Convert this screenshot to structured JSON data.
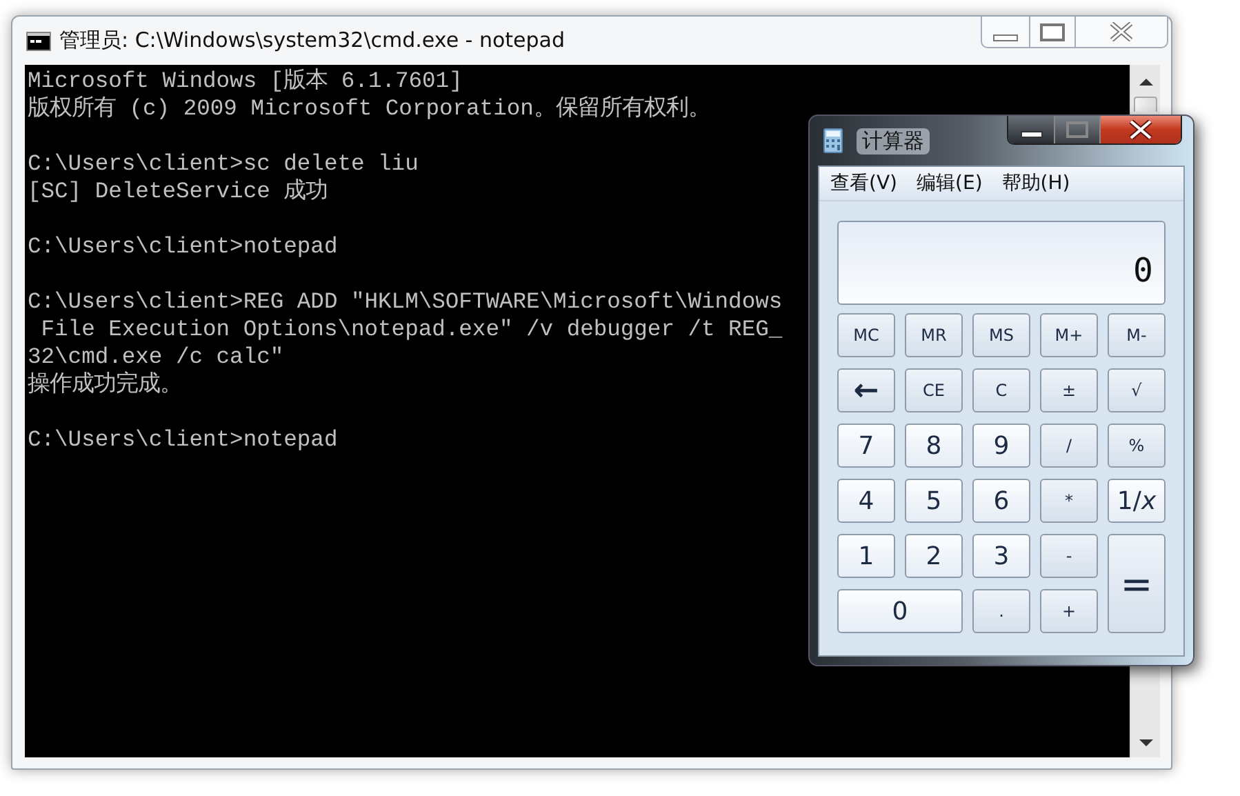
{
  "console_window": {
    "title": "管理员: C:\\Windows\\system32\\cmd.exe - notepad",
    "blocks": [
      [
        "Microsoft Windows [版本 6.1.7601]",
        "版权所有 (c) 2009 Microsoft Corporation。保留所有权利。"
      ],
      [
        "C:\\Users\\client>sc delete liu",
        "[SC] DeleteService 成功"
      ],
      [
        "C:\\Users\\client>notepad"
      ],
      [
        "C:\\Users\\client>REG ADD \"HKLM\\SOFTWARE\\Microsoft\\Windows",
        " File Execution Options\\notepad.exe\" /v debugger /t REG_",
        "32\\cmd.exe /c calc\"",
        "操作成功完成。"
      ],
      [
        "C:\\Users\\client>notepad"
      ]
    ]
  },
  "calculator": {
    "title": "计算器",
    "menu": [
      "查看(V)",
      "编辑(E)",
      "帮助(H)"
    ],
    "display": "0",
    "buttons": [
      {
        "label": "MC",
        "kind": "small"
      },
      {
        "label": "MR",
        "kind": "small"
      },
      {
        "label": "MS",
        "kind": "small"
      },
      {
        "label": "M+",
        "kind": "small"
      },
      {
        "label": "M-",
        "kind": "small"
      },
      {
        "label": "←",
        "kind": "back"
      },
      {
        "label": "CE",
        "kind": "small"
      },
      {
        "label": "C",
        "kind": "small"
      },
      {
        "label": "±",
        "kind": "small"
      },
      {
        "label": "√",
        "kind": "small"
      },
      {
        "label": "7",
        "kind": "digit"
      },
      {
        "label": "8",
        "kind": "digit"
      },
      {
        "label": "9",
        "kind": "digit"
      },
      {
        "label": "/",
        "kind": "small"
      },
      {
        "label": "%",
        "kind": "small"
      },
      {
        "label": "4",
        "kind": "digit"
      },
      {
        "label": "5",
        "kind": "digit"
      },
      {
        "label": "6",
        "kind": "digit"
      },
      {
        "label": "*",
        "kind": "small"
      },
      {
        "label": "1/*x*",
        "kind": "digit"
      },
      {
        "label": "1",
        "kind": "digit"
      },
      {
        "label": "2",
        "kind": "digit"
      },
      {
        "label": "3",
        "kind": "digit"
      },
      {
        "label": "-",
        "kind": "small"
      },
      {
        "label": "=",
        "kind": "tall"
      },
      {
        "label": "0",
        "kind": "wide"
      },
      {
        "label": ".",
        "kind": "small"
      },
      {
        "label": "+",
        "kind": "small"
      }
    ]
  }
}
